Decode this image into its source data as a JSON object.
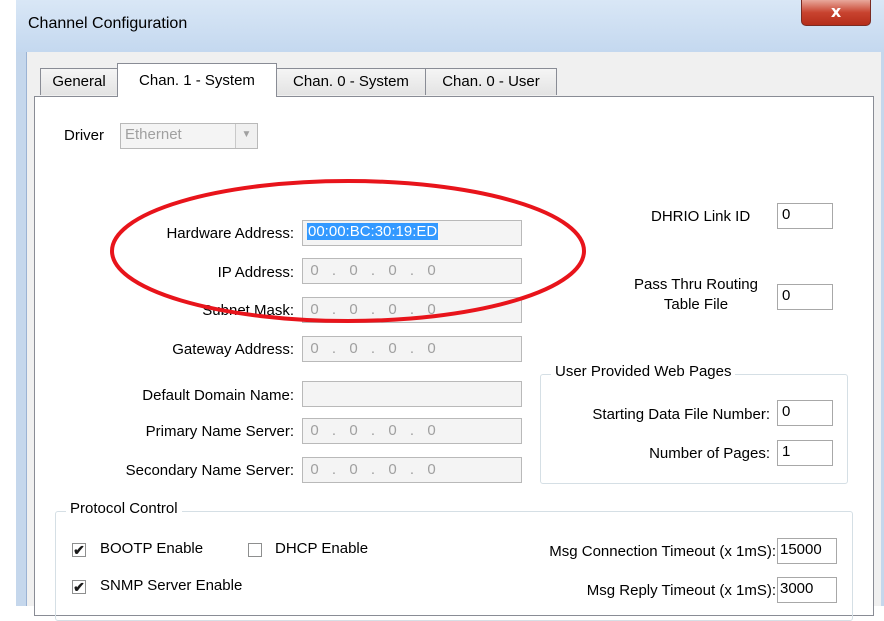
{
  "window": {
    "title": "Channel Configuration",
    "close_glyph": "x"
  },
  "tabs": [
    {
      "label": "General"
    },
    {
      "label": "Chan. 1 - System"
    },
    {
      "label": "Chan. 0 - System"
    },
    {
      "label": "Chan. 0 - User"
    }
  ],
  "driver": {
    "label": "Driver",
    "value": "Ethernet"
  },
  "network": {
    "hardware_address_label": "Hardware Address:",
    "hardware_address_value": "00:00:BC:30:19:ED",
    "ip_address_label": "IP Address:",
    "subnet_mask_label": "Subnet Mask:",
    "gateway_address_label": "Gateway Address:",
    "default_domain_label": "Default Domain Name:",
    "primary_ns_label": "Primary Name Server:",
    "secondary_ns_label": "Secondary Name Server:",
    "octet": "0",
    "octet_sep": "."
  },
  "right": {
    "dhrio_label": "DHRIO Link ID",
    "dhrio_value": "0",
    "pass_thru_label_1": "Pass Thru Routing",
    "pass_thru_label_2": "Table File",
    "pass_thru_value": "0"
  },
  "web_pages": {
    "group_label": "User Provided Web Pages",
    "start_label": "Starting Data File Number:",
    "start_value": "0",
    "pages_label": "Number of Pages:",
    "pages_value": "1"
  },
  "protocol": {
    "group_label": "Protocol Control",
    "bootp_label": "BOOTP Enable",
    "bootp_checked": "✔",
    "dhcp_label": "DHCP Enable",
    "snmp_label": "SNMP Server Enable",
    "snmp_checked": "✔",
    "conn_timeout_label": "Msg Connection Timeout (x 1mS):",
    "conn_timeout_value": "15000",
    "reply_timeout_label": "Msg Reply Timeout (x 1mS):",
    "reply_timeout_value": "3000"
  },
  "colors": {
    "annotation_ring": "#e8141b",
    "selection": "#3399ff"
  }
}
